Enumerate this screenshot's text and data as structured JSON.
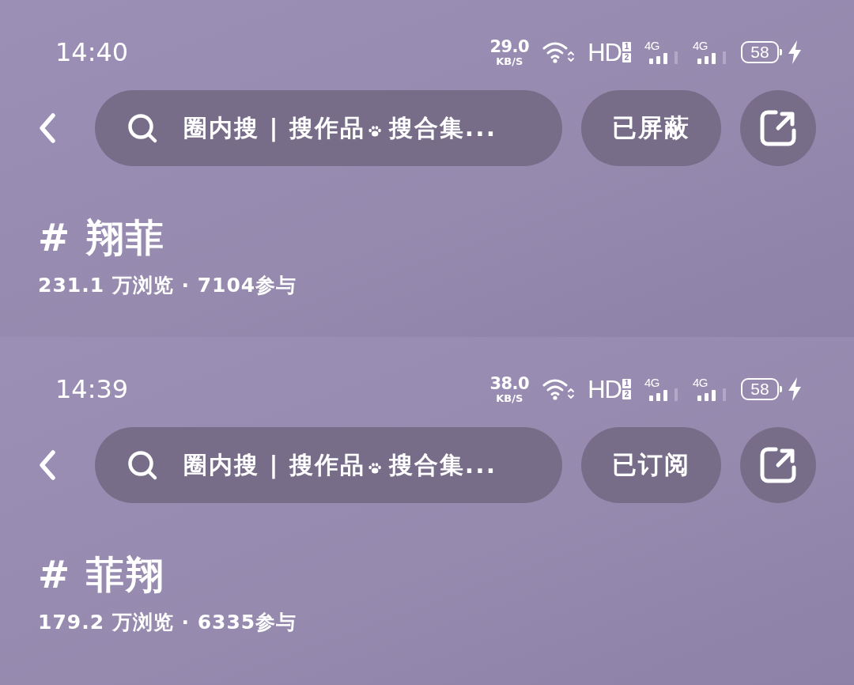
{
  "screens": [
    {
      "status_bar": {
        "time": "14:40",
        "net_speed": {
          "value": "29.0",
          "unit": "KB/S"
        },
        "hd": {
          "label": "HD",
          "sims": [
            "1",
            "2"
          ]
        },
        "signals": [
          {
            "label": "4G"
          },
          {
            "label": "4G"
          }
        ],
        "battery": {
          "percent": "58",
          "charging": true
        }
      },
      "header": {
        "search": {
          "placeholder": [
            "圈内搜 | 搜作品",
            "搜合集..."
          ]
        },
        "action_button": "已屏蔽"
      },
      "topic": {
        "title": "# 翔菲",
        "stats": "231.1 万浏览 · 7104参与"
      }
    },
    {
      "status_bar": {
        "time": "14:39",
        "net_speed": {
          "value": "38.0",
          "unit": "KB/S"
        },
        "hd": {
          "label": "HD",
          "sims": [
            "1",
            "2"
          ]
        },
        "signals": [
          {
            "label": "4G"
          },
          {
            "label": "4G"
          }
        ],
        "battery": {
          "percent": "58",
          "charging": true
        }
      },
      "header": {
        "search": {
          "placeholder": [
            "圈内搜 | 搜作品",
            "搜合集..."
          ]
        },
        "action_button": "已订阅"
      },
      "topic": {
        "title": "# 菲翔",
        "stats": "179.2 万浏览 · 6335参与"
      }
    }
  ]
}
